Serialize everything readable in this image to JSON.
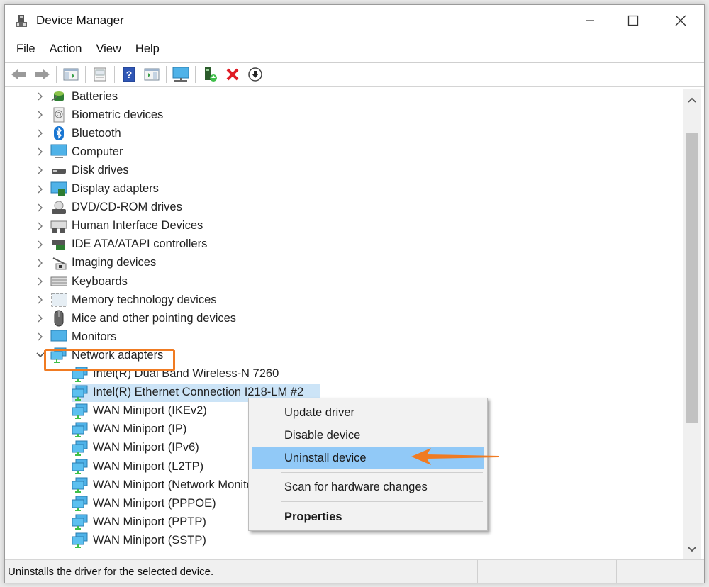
{
  "window": {
    "title": "Device Manager",
    "controls": {
      "minimize": "minimize",
      "maximize": "maximize",
      "close": "close"
    }
  },
  "menubar": {
    "items": [
      {
        "label": "File"
      },
      {
        "label": "Action"
      },
      {
        "label": "View"
      },
      {
        "label": "Help"
      }
    ]
  },
  "toolbar": {
    "buttons": [
      {
        "name": "back",
        "icon": "back-arrow-icon"
      },
      {
        "name": "forward",
        "icon": "forward-arrow-icon"
      },
      {
        "name": "show-hide-console-tree",
        "icon": "console-tree-icon"
      },
      {
        "name": "properties",
        "icon": "properties-sheet-icon"
      },
      {
        "name": "help",
        "icon": "help-icon"
      },
      {
        "name": "show-action-pane",
        "icon": "action-pane-icon"
      },
      {
        "name": "scan-hardware",
        "icon": "monitor-scan-icon"
      },
      {
        "name": "update-driver",
        "icon": "update-driver-icon"
      },
      {
        "name": "uninstall-device",
        "icon": "red-x-icon"
      },
      {
        "name": "disable-device",
        "icon": "down-arrow-circle-icon"
      }
    ]
  },
  "tree": {
    "categories": [
      {
        "label": "Batteries",
        "icon": "battery-icon",
        "expanded": false
      },
      {
        "label": "Biometric devices",
        "icon": "fingerprint-icon",
        "expanded": false
      },
      {
        "label": "Bluetooth",
        "icon": "bluetooth-icon",
        "expanded": false
      },
      {
        "label": "Computer",
        "icon": "computer-icon",
        "expanded": false
      },
      {
        "label": "Disk drives",
        "icon": "disk-drive-icon",
        "expanded": false
      },
      {
        "label": "Display adapters",
        "icon": "display-adapter-icon",
        "expanded": false
      },
      {
        "label": "DVD/CD-ROM drives",
        "icon": "dvd-drive-icon",
        "expanded": false
      },
      {
        "label": "Human Interface Devices",
        "icon": "hid-icon",
        "expanded": false
      },
      {
        "label": "IDE ATA/ATAPI controllers",
        "icon": "ide-controller-icon",
        "expanded": false
      },
      {
        "label": "Imaging devices",
        "icon": "imaging-device-icon",
        "expanded": false
      },
      {
        "label": "Keyboards",
        "icon": "keyboard-icon",
        "expanded": false
      },
      {
        "label": "Memory technology devices",
        "icon": "memory-device-icon",
        "expanded": false
      },
      {
        "label": "Mice and other pointing devices",
        "icon": "mouse-icon",
        "expanded": false
      },
      {
        "label": "Monitors",
        "icon": "monitor-icon",
        "expanded": false
      },
      {
        "label": "Network adapters",
        "icon": "network-adapter-icon",
        "expanded": true,
        "highlighted": true
      }
    ],
    "network_adapters": [
      {
        "label": "Intel(R) Dual Band Wireless-N 7260",
        "selected": false
      },
      {
        "label": "Intel(R) Ethernet Connection I218-LM #2",
        "selected": true
      },
      {
        "label": "WAN Miniport (IKEv2)",
        "selected": false
      },
      {
        "label": "WAN Miniport (IP)",
        "selected": false
      },
      {
        "label": "WAN Miniport (IPv6)",
        "selected": false
      },
      {
        "label": "WAN Miniport (L2TP)",
        "selected": false
      },
      {
        "label": "WAN Miniport (Network Monitor)",
        "selected": false
      },
      {
        "label": "WAN Miniport (PPPOE)",
        "selected": false
      },
      {
        "label": "WAN Miniport (PPTP)",
        "selected": false
      },
      {
        "label": "WAN Miniport (SSTP)",
        "selected": false
      }
    ]
  },
  "context_menu": {
    "items": [
      {
        "label": "Update driver"
      },
      {
        "label": "Disable device"
      },
      {
        "label": "Uninstall device",
        "active": true
      },
      {
        "label": "Scan for hardware changes"
      },
      {
        "label": "Properties",
        "bold": true
      }
    ]
  },
  "statusbar": {
    "text": "Uninstalls the driver for the selected device."
  },
  "colors": {
    "highlight_box": "#f07b22",
    "arrow": "#f07b22",
    "selected_row": "#cce4f7",
    "menu_active": "#91c9f7"
  }
}
